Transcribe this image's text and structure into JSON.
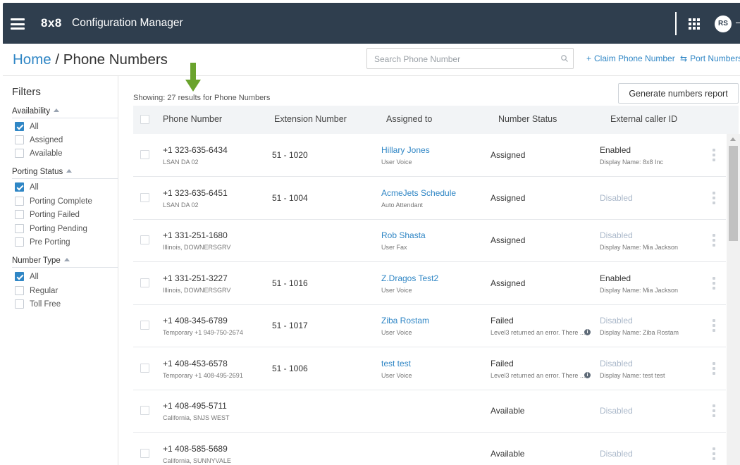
{
  "app": {
    "brand": "8x8",
    "title": "Configuration Manager",
    "user_initials": "RS"
  },
  "breadcrumb": {
    "home": "Home",
    "separator": " / ",
    "current": "Phone Numbers"
  },
  "search": {
    "placeholder": "Search Phone Number"
  },
  "actions": {
    "claim_icon": "+",
    "claim_label": "Claim Phone Number",
    "port_icon": "⇆",
    "port_label": "Port Numbers",
    "report_label": "Generate numbers report"
  },
  "filters": {
    "title": "Filters",
    "availability": {
      "label": "Availability",
      "options": [
        {
          "label": "All",
          "checked": true
        },
        {
          "label": "Assigned",
          "checked": false
        },
        {
          "label": "Available",
          "checked": false
        }
      ]
    },
    "porting_status": {
      "label": "Porting Status",
      "options": [
        {
          "label": "All",
          "checked": true
        },
        {
          "label": "Porting Complete",
          "checked": false
        },
        {
          "label": "Porting Failed",
          "checked": false
        },
        {
          "label": "Porting Pending",
          "checked": false
        },
        {
          "label": "Pre Porting",
          "checked": false
        }
      ]
    },
    "number_type": {
      "label": "Number Type",
      "options": [
        {
          "label": "All",
          "checked": true
        },
        {
          "label": "Regular",
          "checked": false
        },
        {
          "label": "Toll Free",
          "checked": false
        }
      ]
    }
  },
  "results": {
    "showing": "Showing: 27 results for Phone Numbers"
  },
  "table": {
    "columns": [
      "Phone Number",
      "Extension Number",
      "Assigned to",
      "Number Status",
      "External caller ID"
    ],
    "rows": [
      {
        "number": "+1 323-635-6434",
        "location": "LSAN DA 02",
        "extension": "51 - 1020",
        "assigned_name": "Hillary Jones",
        "assigned_type": "User Voice",
        "status": "Assigned",
        "status_detail": "",
        "caller_id": "Enabled",
        "caller_id_enabled": true,
        "display_name": "Display Name: 8x8 Inc"
      },
      {
        "number": "+1 323-635-6451",
        "location": "LSAN DA 02",
        "extension": "51 - 1004",
        "assigned_name": "AcmeJets Schedule",
        "assigned_type": "Auto Attendant",
        "status": "Assigned",
        "status_detail": "",
        "caller_id": "Disabled",
        "caller_id_enabled": false,
        "display_name": ""
      },
      {
        "number": "+1 331-251-1680",
        "location": "Illinois, DOWNERSGRV",
        "extension": "",
        "assigned_name": "Rob Shasta",
        "assigned_type": "User Fax",
        "status": "Assigned",
        "status_detail": "",
        "caller_id": "Disabled",
        "caller_id_enabled": false,
        "display_name": "Display Name: Mia Jackson"
      },
      {
        "number": "+1 331-251-3227",
        "location": "Illinois, DOWNERSGRV",
        "extension": "51 - 1016",
        "assigned_name": "Z.Dragos Test2",
        "assigned_type": "User Voice",
        "status": "Assigned",
        "status_detail": "",
        "caller_id": "Enabled",
        "caller_id_enabled": true,
        "display_name": "Display Name: Mia Jackson"
      },
      {
        "number": "+1 408-345-6789",
        "location": "Temporary +1 949-750-2674",
        "extension": "51 - 1017",
        "assigned_name": "Ziba Rostam",
        "assigned_type": "User Voice",
        "status": "Failed",
        "status_detail": "Level3 returned an error. There ...",
        "caller_id": "Disabled",
        "caller_id_enabled": false,
        "display_name": "Display Name: Ziba Rostam"
      },
      {
        "number": "+1 408-453-6578",
        "location": "Temporary +1 408-495-2691",
        "extension": "51 - 1006",
        "assigned_name": "test test",
        "assigned_type": "User Voice",
        "status": "Failed",
        "status_detail": "Level3 returned an error. There ...",
        "caller_id": "Disabled",
        "caller_id_enabled": false,
        "display_name": "Display Name: test test"
      },
      {
        "number": "+1 408-495-5711",
        "location": "California, SNJS WEST",
        "extension": "",
        "assigned_name": "",
        "assigned_type": "",
        "status": "Available",
        "status_detail": "",
        "caller_id": "Disabled",
        "caller_id_enabled": false,
        "display_name": ""
      },
      {
        "number": "+1 408-585-5689",
        "location": "California, SUNNYVALE",
        "extension": "",
        "assigned_name": "",
        "assigned_type": "",
        "status": "Available",
        "status_detail": "",
        "caller_id": "Disabled",
        "caller_id_enabled": false,
        "display_name": ""
      }
    ]
  },
  "colors": {
    "topbar": "#2f3e4e",
    "link": "#2f86c5",
    "checkbox_checked": "#2f86c5",
    "disabled_text": "#a9b7c9",
    "annotation_arrow": "#6aa32d"
  }
}
